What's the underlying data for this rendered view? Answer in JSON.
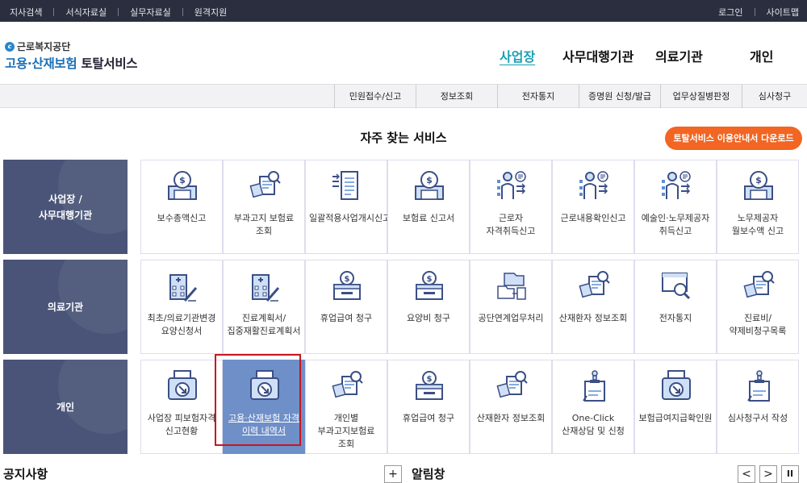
{
  "topbar": {
    "left": [
      "지사검색",
      "서식자료실",
      "실무자료실",
      "원격지원"
    ],
    "right": [
      "로그인",
      "사이트맵"
    ]
  },
  "logo": {
    "org": "근로복지공단",
    "main_blue": "고용·산재보험",
    "main_dark": "토탈서비스"
  },
  "gnb": [
    "사업장",
    "사무대행기관",
    "의료기관",
    "개인"
  ],
  "subnav": [
    "민원접수/신고",
    "정보조회",
    "전자통지",
    "증명원 신청/발급",
    "업무상질병판정",
    "심사청구"
  ],
  "section": {
    "title": "자주 찾는 서비스",
    "download_label": "토탈서비스 이용안내서 다운로드"
  },
  "categories": [
    {
      "label_l1": "사업장 /",
      "label_l2": "사무대행기관"
    },
    {
      "label_l1": "의료기관",
      "label_l2": ""
    },
    {
      "label_l1": "개인",
      "label_l2": ""
    }
  ],
  "rows": [
    [
      {
        "label": "보수총액신고",
        "icon": "money-report-icon"
      },
      {
        "label": "부과고지 보험료 조회",
        "icon": "doc-search-icon"
      },
      {
        "label": "일괄적용사업개시신고",
        "icon": "documents-icon"
      },
      {
        "label": "보험료 신고서",
        "icon": "money-report-icon"
      },
      {
        "label": "근로자 자격취득신고",
        "icon": "person-list-icon"
      },
      {
        "label": "근로내용확인신고",
        "icon": "person-list-icon"
      },
      {
        "label": "예술인·노무제공자 취득신고",
        "icon": "person-list-icon"
      },
      {
        "label": "노무제공자 월보수액 신고",
        "icon": "money-report-icon"
      }
    ],
    [
      {
        "label": "최초/의료기관변경 요양신청서",
        "icon": "hospital-pen-icon"
      },
      {
        "label": "진료계획서/집중재활진료계획서",
        "icon": "hospital-pen-icon"
      },
      {
        "label": "휴업급여 청구",
        "icon": "money-box-icon"
      },
      {
        "label": "요양비 청구",
        "icon": "money-box-icon"
      },
      {
        "label": "공단연계업무처리",
        "icon": "folder-link-icon"
      },
      {
        "label": "산재환자 정보조회",
        "icon": "doc-search-icon"
      },
      {
        "label": "전자통지",
        "icon": "monitor-search-icon"
      },
      {
        "label": "진료비/약제비청구목록",
        "icon": "doc-search-icon"
      }
    ],
    [
      {
        "label": "사업장 피보험자격 신고현황",
        "icon": "printer-icon"
      },
      {
        "label": "고용·산재보험 자격 이력 내역서",
        "icon": "printer-icon"
      },
      {
        "label": "개인별 부과고지보험료 조회",
        "icon": "doc-search-icon"
      },
      {
        "label": "휴업급여 청구",
        "icon": "money-box-icon"
      },
      {
        "label": "산재환자 정보조회",
        "icon": "doc-search-icon"
      },
      {
        "label": "One-Click 산재상담 및 신청",
        "icon": "stamp-doc-icon"
      },
      {
        "label": "보험급여지급확인원",
        "icon": "printer-icon"
      },
      {
        "label": "심사청구서 작성",
        "icon": "stamp-doc-icon"
      }
    ]
  ],
  "bottom": {
    "notice_title": "공지사항",
    "plus": "+",
    "alert_title": "알림창",
    "prev": "<",
    "next": ">",
    "pause": "II"
  },
  "colors": {
    "topbar": "#2b2e3e",
    "category_bg": "#4a5478",
    "accent_orange": "#f26522",
    "active_menu": "#1a9fb4",
    "selected_cell": "#6f8fc8",
    "highlight_border": "#c8161d"
  }
}
